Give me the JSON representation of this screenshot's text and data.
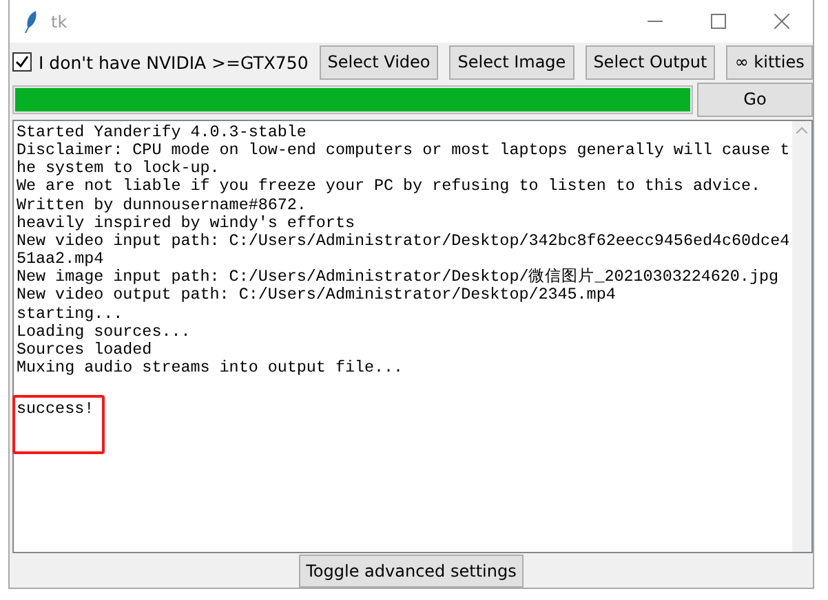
{
  "window": {
    "title": "tk"
  },
  "toolbar": {
    "checkbox": {
      "label": "I don't have NVIDIA >=GTX750",
      "checked": true
    },
    "buttons": [
      "Select Video",
      "Select Image",
      "Select Output",
      "∞ kitties"
    ]
  },
  "progress": {
    "level": 1.0,
    "button": "Go"
  },
  "log": [
    {
      "text": "Started Yanderify 4.0.3-stable",
      "highlighted": false
    },
    {
      "text": "Disclaimer: CPU mode on low-end computers or most laptops generally will cause t",
      "highlighted": false
    },
    {
      "text": "he system to lock-up.",
      "highlighted": false
    },
    {
      "text": "We are not liable if you freeze your PC by refusing to listen to this advice.",
      "highlighted": false
    },
    {
      "text": "Written by dunnousername#8672.",
      "highlighted": false
    },
    {
      "text": "heavily inspired by windy's efforts",
      "highlighted": false
    },
    {
      "text": "New video input path: C:/Users/Administrator/Desktop/342bc8f62eecc9456ed4c60dce4",
      "highlighted": false
    },
    {
      "text": "51aa2.mp4",
      "highlighted": false
    },
    {
      "text": "New image input path: C:/Users/Administrator/Desktop/微信图片_20210303224620.jpg",
      "highlighted": false
    },
    {
      "text": "New video output path: C:/Users/Administrator/Desktop/2345.mp4",
      "highlighted": false
    },
    {
      "text": "starting...",
      "highlighted": false
    },
    {
      "text": "Loading sources...",
      "highlighted": false
    },
    {
      "text": "Sources loaded",
      "highlighted": false
    },
    {
      "text": "Muxing audio streams into output file...",
      "highlighted": false
    },
    {
      "text": "success!",
      "highlighted": true
    }
  ],
  "bottom_button": "Toggle advanced settings"
}
